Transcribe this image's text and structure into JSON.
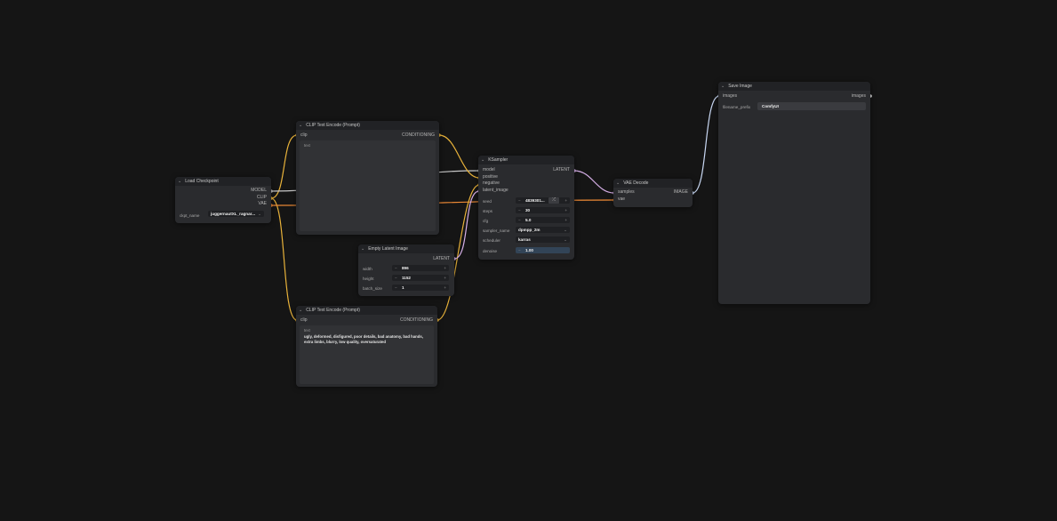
{
  "colors": {
    "background": "#151515",
    "node_body": "#2a2b2e",
    "node_header": "#212225",
    "wire_clip": "#e8b23a",
    "wire_vae": "#ee8a35",
    "wire_model": "#c8c8c8",
    "wire_latent": "#d7b0e8",
    "wire_image": "#c8d7f2"
  },
  "nodes": {
    "load_checkpoint": {
      "title": "Load Checkpoint",
      "outputs": [
        "MODEL",
        "CLIP",
        "VAE"
      ],
      "ckpt_label": "ckpt_name",
      "ckpt_value": "juggernautXL_ragnar..."
    },
    "clip_pos": {
      "title": "CLIP Text Encode (Prompt)",
      "input": "clip",
      "output": "CONDITIONING",
      "text_label": "text",
      "text_value": ""
    },
    "clip_neg": {
      "title": "CLIP Text Encode (Prompt)",
      "input": "clip",
      "output": "CONDITIONING",
      "text_label": "text",
      "text_value": "ugly, deformed, disfigured, poor details, bad anatomy, bad hands, extra limbs, blurry, low quality, oversaturated"
    },
    "empty_latent": {
      "title": "Empty Latent Image",
      "output": "LATENT",
      "width_label": "width",
      "width_value": "896",
      "height_label": "height",
      "height_value": "1152",
      "batch_label": "batch_size",
      "batch_value": "1"
    },
    "ksampler": {
      "title": "KSampler",
      "inputs": [
        "model",
        "positive",
        "negative",
        "latent_image"
      ],
      "output": "LATENT",
      "seed_label": "seed",
      "seed_value": "4839301...",
      "steps_label": "steps",
      "steps_value": "30",
      "cfg_label": "cfg",
      "cfg_value": "5.0",
      "sampler_label": "sampler_name",
      "sampler_value": "dpmpp_2m",
      "scheduler_label": "scheduler",
      "scheduler_value": "karras",
      "denoise_label": "denoise",
      "denoise_value": "1.00"
    },
    "vae_decode": {
      "title": "VAE Decode",
      "inputs": [
        "samples",
        "vae"
      ],
      "output": "IMAGE"
    },
    "save_image": {
      "title": "Save Image",
      "input": "images",
      "output": "images",
      "prefix_label": "filename_prefix",
      "prefix_value": "ComfyUI"
    }
  }
}
